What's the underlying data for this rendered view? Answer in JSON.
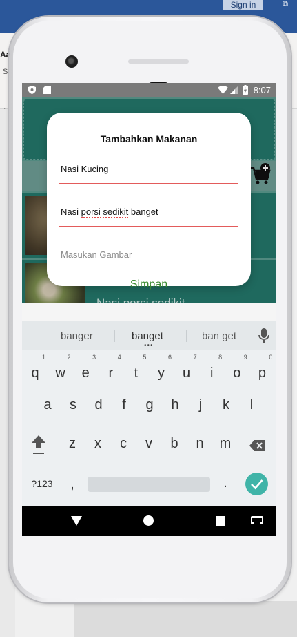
{
  "host": {
    "signin_label": "Sign in",
    "restore_glyph": "⧉",
    "fragment_1": "Aal",
    "fragment_2": "S",
    "fragment_3": "· :"
  },
  "statusbar": {
    "time": "8:07",
    "icons": [
      "shield-icon",
      "sd-card-icon",
      "wifi-icon",
      "signal-icon",
      "battery-charging-icon"
    ]
  },
  "app": {
    "cart_icon": "add-to-cart-icon",
    "rows": [
      {
        "image": "food-thumbnail",
        "text": ""
      },
      {
        "image": "food-thumbnail",
        "text": "Nasi porsi sedikit"
      }
    ]
  },
  "dialog": {
    "title": "Tambahkan Makanan",
    "name_value": "Nasi Kucing",
    "desc_value_pre": "Nasi ",
    "desc_value_misspelled": "porsi sedikit",
    "desc_value_post": " banget",
    "image_placeholder": "Masukan Gambar",
    "save_label": "Simpan"
  },
  "keyboard": {
    "suggestions": [
      "banger",
      "banget",
      "ban get"
    ],
    "row1": [
      {
        "k": "q",
        "n": "1"
      },
      {
        "k": "w",
        "n": "2"
      },
      {
        "k": "e",
        "n": "3"
      },
      {
        "k": "r",
        "n": "4"
      },
      {
        "k": "t",
        "n": "5"
      },
      {
        "k": "y",
        "n": "6"
      },
      {
        "k": "u",
        "n": "7"
      },
      {
        "k": "i",
        "n": "8"
      },
      {
        "k": "o",
        "n": "9"
      },
      {
        "k": "p",
        "n": "0"
      }
    ],
    "row2": [
      "a",
      "s",
      "d",
      "f",
      "g",
      "h",
      "j",
      "k",
      "l"
    ],
    "row3": [
      "z",
      "x",
      "c",
      "v",
      "b",
      "n",
      "m"
    ],
    "symbols_label": "?123",
    "comma_label": ",",
    "period_label": ".",
    "accent_color": "#40b4a8"
  },
  "colors": {
    "app_primary": "#24786c",
    "field_underline": "#e35b5b",
    "save_text": "#3a8a2f"
  }
}
